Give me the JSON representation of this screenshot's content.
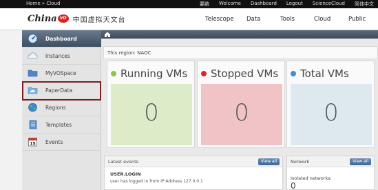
{
  "topbar": {
    "breadcrumb": "Home » Cloud",
    "links": [
      "要鹏",
      "Welcome",
      "Dashboard",
      "Logout",
      "ScienceCloud",
      "简体中文"
    ]
  },
  "header": {
    "logo_text": "China",
    "logo_badge": "VO",
    "logo_cn": "中国虚拟天文台",
    "nav": [
      "Telescope",
      "Data",
      "Tools",
      "Cloud",
      "Public"
    ]
  },
  "sidebar": {
    "items": [
      {
        "label": "Dashboard",
        "icon": "dashboard-icon"
      },
      {
        "label": "Instances",
        "icon": "cloud-icon"
      },
      {
        "label": "MyVOSpace",
        "icon": "folder-icon"
      },
      {
        "label": "PaperData",
        "icon": "folder-cloud-icon"
      },
      {
        "label": "Regions",
        "icon": "globe-icon"
      },
      {
        "label": "Templates",
        "icon": "document-icon"
      },
      {
        "label": "Events",
        "icon": "calendar-icon"
      }
    ],
    "calendar_day": "15"
  },
  "main": {
    "region_text": "This region: NAOC",
    "cards": [
      {
        "title": "Running VMs",
        "value": "0",
        "dot_color": "#8bc63f",
        "box_color": "#dcebc8"
      },
      {
        "title": "Stopped VMs",
        "value": "0",
        "dot_color": "#d8262c",
        "box_color": "#f0c4c6"
      },
      {
        "title": "Total VMs",
        "value": "0",
        "dot_color": "#3b8fd8",
        "box_color": "#dde8ef"
      }
    ],
    "events": {
      "title": "Latest events",
      "button": "View all",
      "event_name": "USER.LOGIN",
      "event_desc": "user has logged in from IP Address 127.0.0.1"
    },
    "network": {
      "title": "Network",
      "button": "View all",
      "label": "Isolated networks:",
      "value": "0"
    }
  },
  "colors": {
    "active_sidebar": "#4a5a6d",
    "highlight": "#7a1e22",
    "button": "#4a6f9c"
  }
}
